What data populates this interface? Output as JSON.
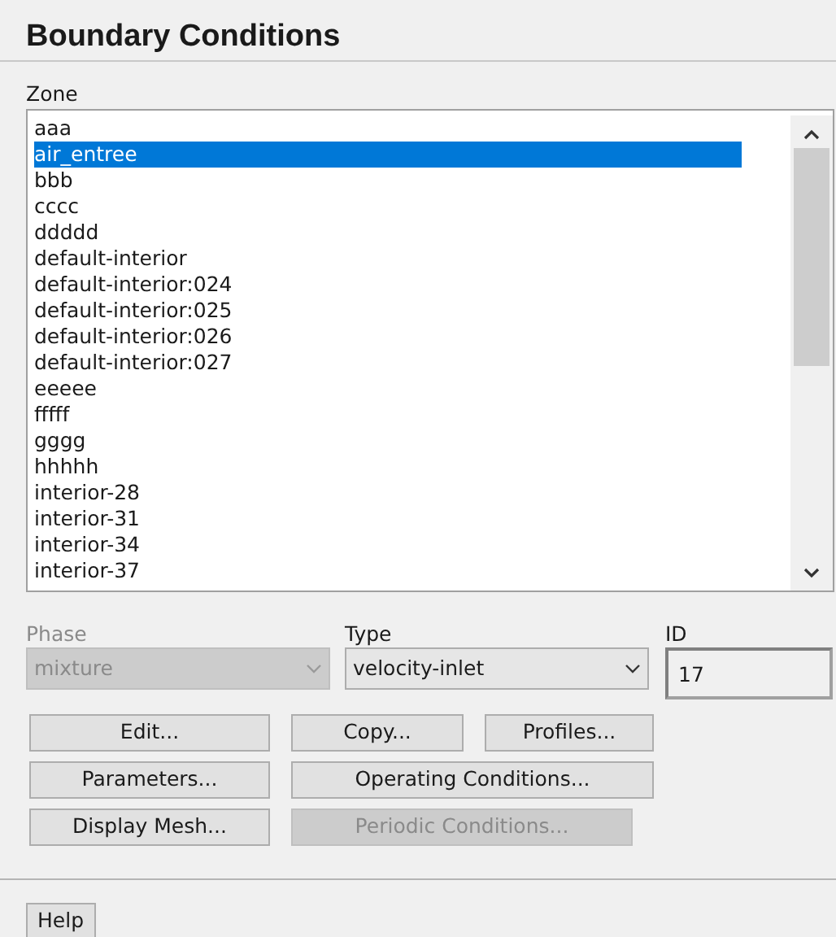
{
  "panel": {
    "title": "Boundary Conditions"
  },
  "zone": {
    "label": "Zone",
    "items": [
      {
        "label": "aaa",
        "selected": false
      },
      {
        "label": "air_entree",
        "selected": true
      },
      {
        "label": "bbb",
        "selected": false
      },
      {
        "label": "cccc",
        "selected": false
      },
      {
        "label": "ddddd",
        "selected": false
      },
      {
        "label": "default-interior",
        "selected": false
      },
      {
        "label": "default-interior:024",
        "selected": false
      },
      {
        "label": "default-interior:025",
        "selected": false
      },
      {
        "label": "default-interior:026",
        "selected": false
      },
      {
        "label": "default-interior:027",
        "selected": false
      },
      {
        "label": "eeeee",
        "selected": false
      },
      {
        "label": "fffff",
        "selected": false
      },
      {
        "label": "gggg",
        "selected": false
      },
      {
        "label": "hhhhh",
        "selected": false
      },
      {
        "label": "interior-28",
        "selected": false
      },
      {
        "label": "interior-31",
        "selected": false
      },
      {
        "label": "interior-34",
        "selected": false
      },
      {
        "label": "interior-37",
        "selected": false
      }
    ]
  },
  "phase": {
    "label": "Phase",
    "value": "mixture",
    "disabled": true
  },
  "type": {
    "label": "Type",
    "value": "velocity-inlet",
    "disabled": false
  },
  "id": {
    "label": "ID",
    "value": "17"
  },
  "buttons": [
    {
      "label": "Edit...",
      "disabled": false
    },
    {
      "label": "Copy...",
      "disabled": false
    },
    {
      "label": "Profiles...",
      "disabled": false
    },
    {
      "label": "Parameters...",
      "disabled": false
    },
    {
      "label": "Operating Conditions...",
      "disabled": false
    },
    {
      "label": "Display Mesh...",
      "disabled": false
    },
    {
      "label": "Periodic Conditions...",
      "disabled": true
    }
  ],
  "help_button": {
    "label": "Help"
  }
}
